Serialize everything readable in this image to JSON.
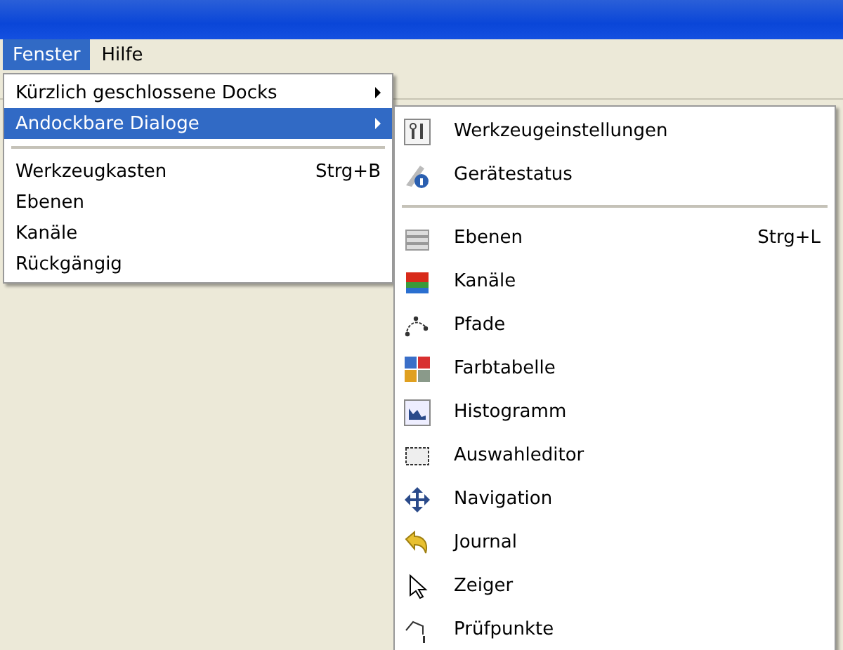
{
  "menubar": [
    {
      "label": "Fenster",
      "selected": true
    },
    {
      "label": "Hilfe",
      "selected": false
    }
  ],
  "window_menu": [
    {
      "kind": "item",
      "label": "Kürzlich geschlossene Docks",
      "submenu": true,
      "selected": false
    },
    {
      "kind": "item",
      "label": "Andockbare Dialoge",
      "submenu": true,
      "selected": true
    },
    {
      "kind": "separator"
    },
    {
      "kind": "item",
      "label": "Werkzeugkasten",
      "shortcut": "Strg+B",
      "selected": false
    },
    {
      "kind": "item",
      "label": "Ebenen",
      "selected": false
    },
    {
      "kind": "item",
      "label": "Kanäle",
      "selected": false
    },
    {
      "kind": "item",
      "label": "Rückgängig",
      "selected": false
    }
  ],
  "dockable_dialogs_menu": [
    {
      "kind": "item",
      "label": "Werkzeugeinstellungen"
    },
    {
      "kind": "item",
      "label": "Gerätestatus"
    },
    {
      "kind": "separator"
    },
    {
      "kind": "item",
      "label": "Ebenen",
      "shortcut": "Strg+L"
    },
    {
      "kind": "item",
      "label": "Kanäle"
    },
    {
      "kind": "item",
      "label": "Pfade"
    },
    {
      "kind": "item",
      "label": "Farbtabelle"
    },
    {
      "kind": "item",
      "label": "Histogramm"
    },
    {
      "kind": "item",
      "label": "Auswahleditor"
    },
    {
      "kind": "item",
      "label": "Navigation"
    },
    {
      "kind": "item",
      "label": "Journal"
    },
    {
      "kind": "item",
      "label": "Zeiger"
    },
    {
      "kind": "item",
      "label": "Prüfpunkte"
    }
  ]
}
